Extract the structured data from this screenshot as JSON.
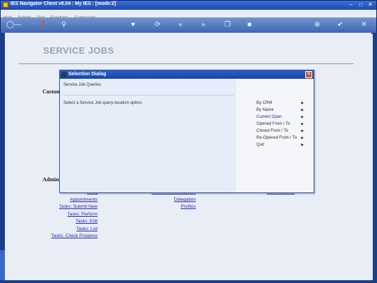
{
  "window": {
    "title": "IES Navigator Client v8.04 : My IES :      [mode:2]"
  },
  "menu": [
    "Help",
    "Submit",
    "Quit",
    "Functions",
    "Commands"
  ],
  "toolbar": {
    "icons": [
      "key-icon",
      "help-icon",
      "search-icon",
      "heart-icon",
      "refresh-icon",
      "back-icon",
      "forward-icon",
      "copy-icon",
      "stop-icon",
      "add-icon",
      "check-icon",
      "close-icon"
    ]
  },
  "page": {
    "title": "SERVICE JOBS"
  },
  "sections": {
    "customer": "Custom",
    "admin": "Admini"
  },
  "links": {
    "col1": [
      "Diary",
      "Appointments",
      "Tasks: Submit New",
      "Tasks: Perform",
      "Tasks: Edit",
      "Tasks: List",
      "Tasks: Check Progress"
    ],
    "col2": [
      "Rule Sheet Templates",
      "Delegation",
      "Profiles"
    ],
    "col3": [
      "Local Options"
    ]
  },
  "dialog": {
    "title": "Selection Dialog",
    "heading": "Service Job Queries",
    "prompt": "Select a Service Job query-location option.",
    "options": [
      "By CRM",
      "By Name",
      "Current Open",
      "Opened From / To",
      "Closed From / To",
      "Re-Opened From / To",
      "Quit"
    ],
    "selected": "Current Open"
  }
}
